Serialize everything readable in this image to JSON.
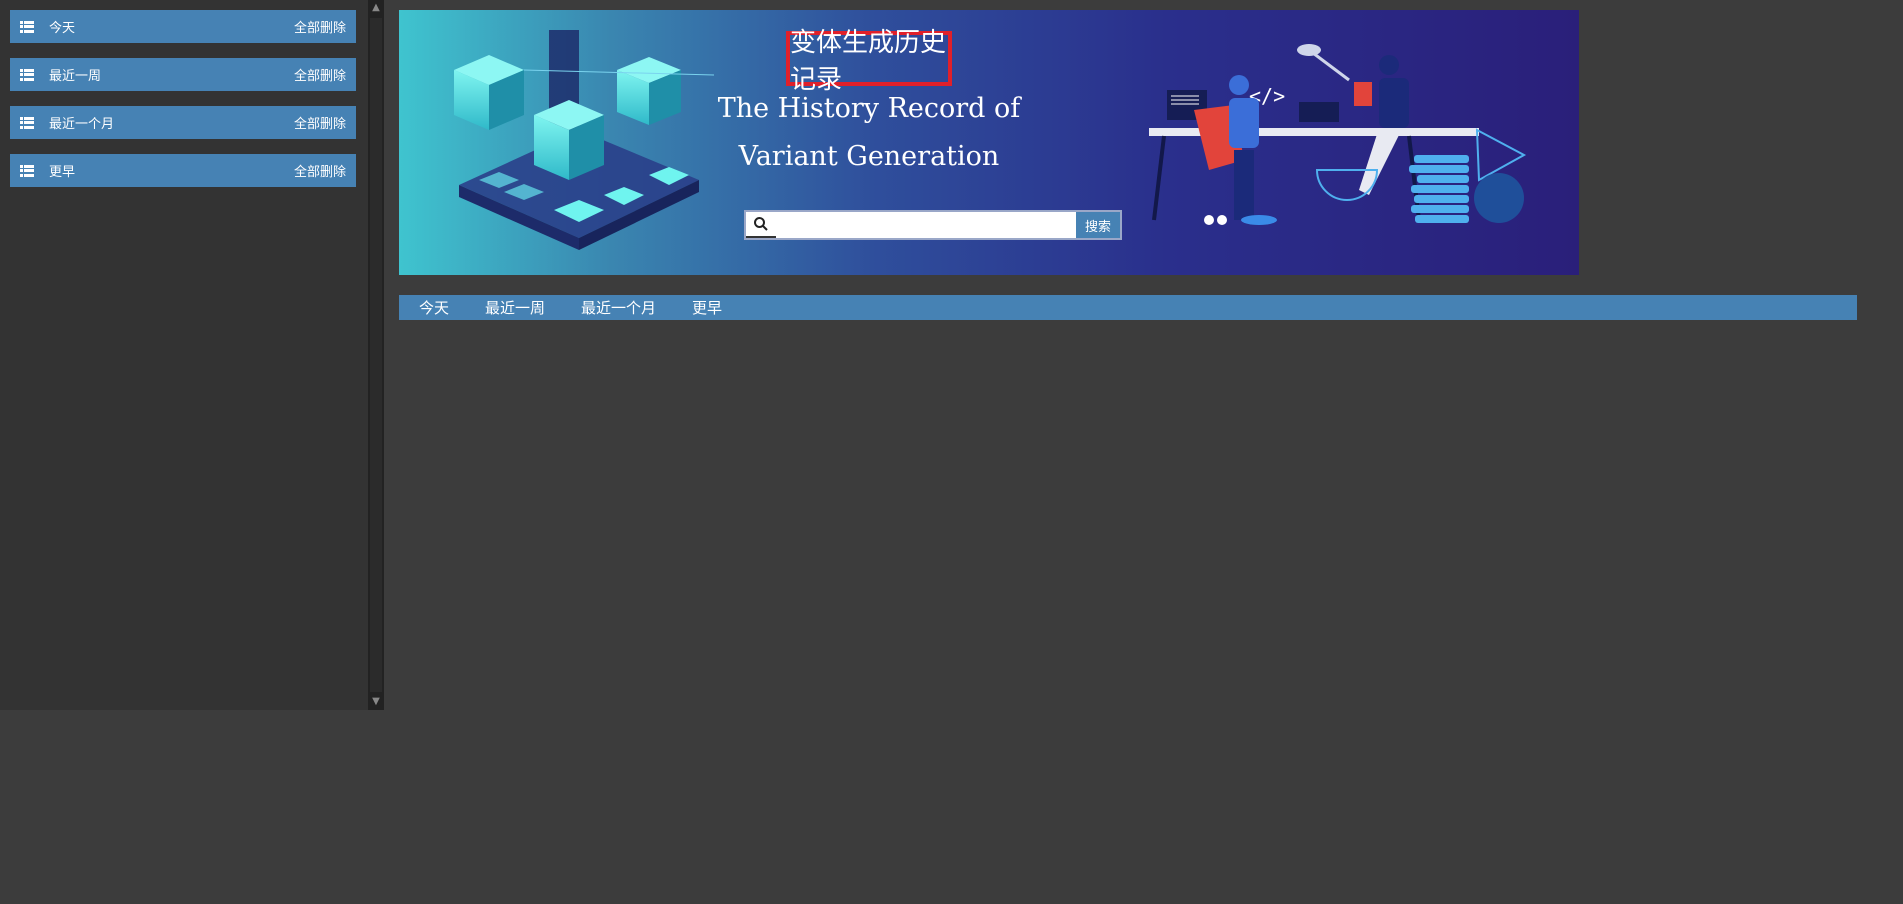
{
  "sidebar": {
    "items": [
      {
        "label": "今天",
        "action": "全部删除"
      },
      {
        "label": "最近一周",
        "action": "全部删除"
      },
      {
        "label": "最近一个月",
        "action": "全部删除"
      },
      {
        "label": "更早",
        "action": "全部删除"
      }
    ]
  },
  "banner": {
    "title_cn": "变体生成历史记录",
    "title_en_line1": "The History Record of",
    "title_en_line2": "Variant Generation",
    "search": {
      "value": "",
      "placeholder": "",
      "button_label": "搜索"
    }
  },
  "nav": {
    "tabs": [
      "今天",
      "最近一周",
      "最近一个月",
      "更早"
    ]
  },
  "colors": {
    "accent": "#4682b4",
    "title_border": "#e0202a",
    "background": "#3c3c3c",
    "sidebar": "#333333"
  }
}
